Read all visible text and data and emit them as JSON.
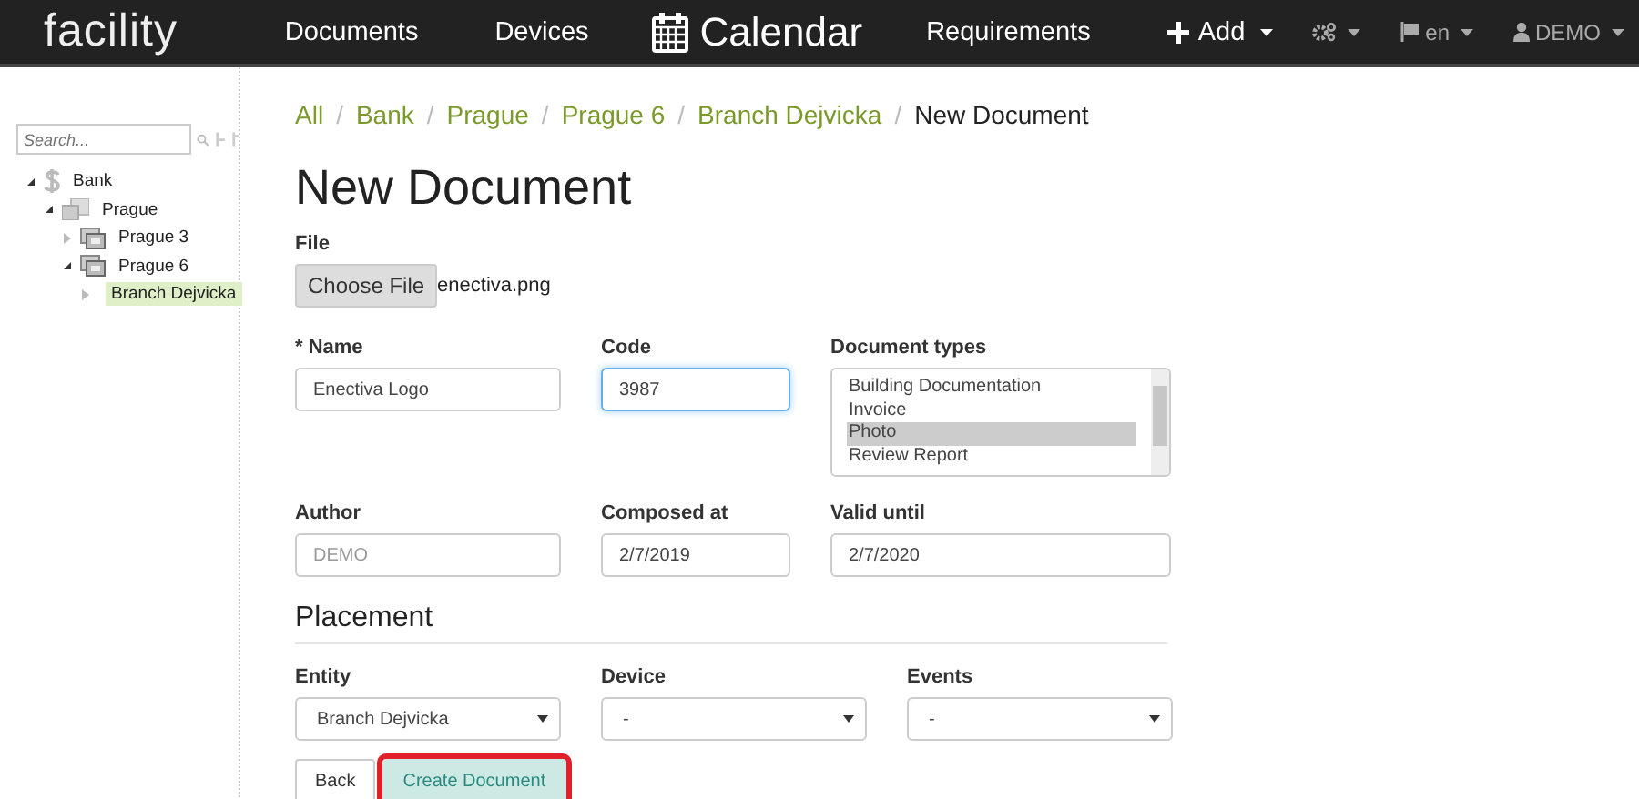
{
  "navbar": {
    "logo": "facility",
    "links": [
      {
        "label": "Documents",
        "kind": "text"
      },
      {
        "label": "Devices",
        "kind": "text"
      },
      {
        "label": "Calendar",
        "kind": "calendar"
      },
      {
        "label": "Requirements",
        "kind": "text"
      },
      {
        "label": "Add",
        "kind": "add"
      }
    ],
    "right": [
      {
        "kind": "gear"
      },
      {
        "kind": "flag",
        "label": "en"
      },
      {
        "kind": "user",
        "label": "DEMO"
      }
    ]
  },
  "sidebar": {
    "search": {
      "placeholder": "Search..."
    },
    "tree": [
      {
        "label": "Bank",
        "kind": "dollar",
        "expanded": true,
        "selected": false,
        "children": [
          {
            "label": "Prague",
            "kind": "city",
            "expanded": true,
            "selected": false,
            "children": [
              {
                "label": "Prague 3",
                "kind": "district",
                "expanded": false,
                "selected": false
              },
              {
                "label": "Prague 6",
                "kind": "district",
                "expanded": true,
                "selected": false,
                "children": [
                  {
                    "label": "Branch Dejvicka",
                    "kind": "branch",
                    "expanded": false,
                    "selected": true
                  }
                ]
              }
            ]
          }
        ]
      }
    ]
  },
  "breadcrumb_separator": "/",
  "breadcrumbs": [
    {
      "label": "All",
      "current": false
    },
    {
      "label": "Bank",
      "current": false
    },
    {
      "label": "Prague",
      "current": false
    },
    {
      "label": "Prague 6",
      "current": false
    },
    {
      "label": "Branch Dejvicka",
      "current": false
    },
    {
      "label": "New Document",
      "current": true
    }
  ],
  "title": "New Document",
  "file": {
    "label": "File",
    "button": "Choose File",
    "filename": "enectiva.png"
  },
  "fields": [
    {
      "label": "* Name",
      "kind": "input",
      "value": "Enectiva Logo",
      "focused": false
    },
    {
      "label": "Code",
      "kind": "input",
      "value": "3987",
      "focused": true
    },
    {
      "label": "Document types",
      "kind": "list",
      "options": [
        {
          "label": "Building Documentation",
          "selected": false
        },
        {
          "label": "Invoice",
          "selected": false
        },
        {
          "label": "Photo",
          "selected": true
        },
        {
          "label": "Review Report",
          "selected": false
        }
      ]
    },
    {
      "label": "Author",
      "kind": "input",
      "placeholder": "DEMO",
      "focused": false
    },
    {
      "label": "Composed at",
      "kind": "input",
      "value": "2/7/2019",
      "focused": false
    },
    {
      "label": "Valid until",
      "kind": "input",
      "value": "2/7/2020",
      "focused": false
    }
  ],
  "placement": {
    "title": "Placement",
    "fields": [
      {
        "label": "Entity",
        "value": "Branch Dejvicka"
      },
      {
        "label": "Device",
        "value": "-"
      },
      {
        "label": "Events",
        "value": "-"
      }
    ]
  },
  "buttons": [
    {
      "label": "Back",
      "kind": "default",
      "highlighted": false
    },
    {
      "label": "Create Document",
      "kind": "primary",
      "highlighted": true
    }
  ]
}
